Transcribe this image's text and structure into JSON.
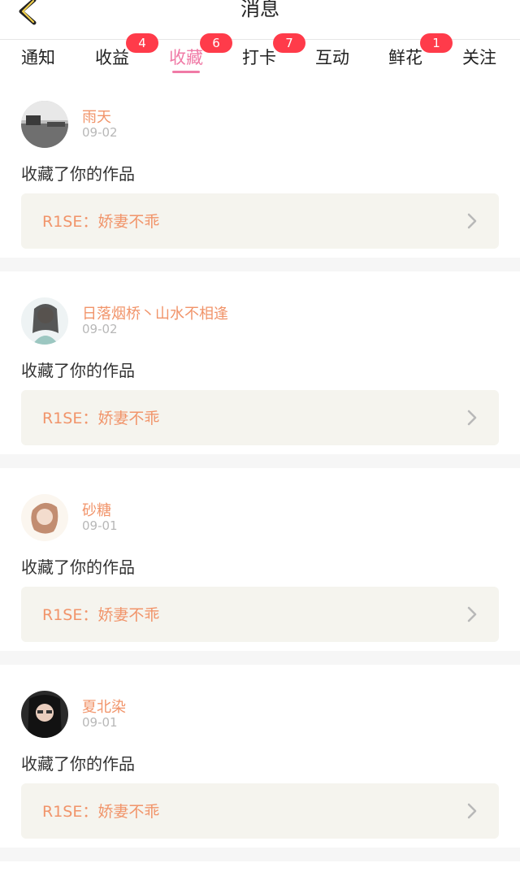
{
  "header": {
    "title": "消息"
  },
  "tabs": [
    {
      "label": "通知",
      "badge": ""
    },
    {
      "label": "收益",
      "badge": "4"
    },
    {
      "label": "收藏",
      "badge": "6",
      "active": true
    },
    {
      "label": "打卡",
      "badge": "7"
    },
    {
      "label": "互动",
      "badge": ""
    },
    {
      "label": "鲜花",
      "badge": "1"
    },
    {
      "label": "关注",
      "badge": ""
    }
  ],
  "items": [
    {
      "user": "雨天",
      "date": "09-02",
      "action": "收藏了你的作品",
      "work": "R1SE：娇妻不乖"
    },
    {
      "user": "日落烟桥丶山水不相逢",
      "date": "09-02",
      "action": "收藏了你的作品",
      "work": "R1SE：娇妻不乖"
    },
    {
      "user": "砂糖",
      "date": "09-01",
      "action": "收藏了你的作品",
      "work": "R1SE：娇妻不乖"
    },
    {
      "user": "夏北染",
      "date": "09-01",
      "action": "收藏了你的作品",
      "work": "R1SE：娇妻不乖"
    }
  ],
  "colors": {
    "accent": "#f07aa6",
    "badge": "#ff3b4a",
    "username": "#f1946a"
  }
}
